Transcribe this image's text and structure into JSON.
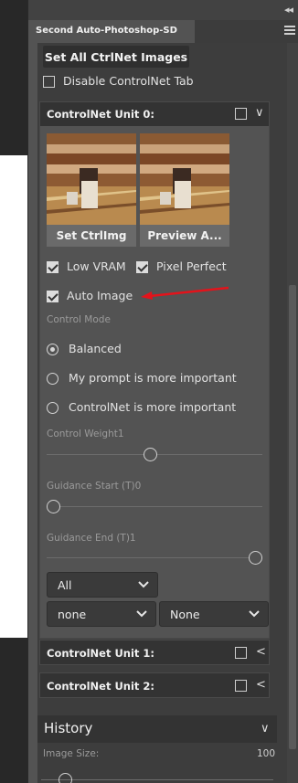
{
  "panel": {
    "tab_title": "Second Auto-Photoshop-SD",
    "set_all_button": "Set All CtrlNet Images",
    "disable_tab_label": "Disable ControlNet Tab",
    "disable_tab_checked": false
  },
  "unit0": {
    "title": "ControlNet Unit 0:",
    "enabled": false,
    "expanded_icon": "chevron-down-icon",
    "set_img_button": "Set CtrlImg",
    "preview_button": "Preview A...",
    "low_vram_label": "Low VRAM",
    "low_vram_checked": true,
    "pixel_perfect_label": "Pixel Perfect",
    "pixel_perfect_checked": true,
    "auto_image_label": "Auto Image",
    "auto_image_checked": true,
    "control_mode_label": "Control Mode",
    "modes": [
      {
        "label": "Balanced",
        "selected": true
      },
      {
        "label": "My prompt is more important",
        "selected": false
      },
      {
        "label": "ControlNet is more important",
        "selected": false
      }
    ],
    "control_weight_label": "Control Weight1",
    "control_weight_value": 1,
    "guidance_start_label": "Guidance Start (T)0",
    "guidance_start_value": 0,
    "guidance_end_label": "Guidance End (T)1",
    "guidance_end_value": 1,
    "dropdown_all": "All",
    "dropdown_preprocessor": "none",
    "dropdown_model": "None"
  },
  "unit1": {
    "title": "ControlNet Unit 1:",
    "enabled": false,
    "collapsed_icon": "chevron-left-icon"
  },
  "unit2": {
    "title": "ControlNet Unit 2:",
    "enabled": false,
    "collapsed_icon": "chevron-left-icon"
  },
  "history": {
    "title": "History",
    "image_size_label": "Image Size:",
    "image_size_value": "100"
  },
  "colors": {
    "panel_bg": "#535353",
    "content_bg": "#3d3d3d",
    "header_bg": "#333333",
    "arrow_red": "#e3131b"
  }
}
